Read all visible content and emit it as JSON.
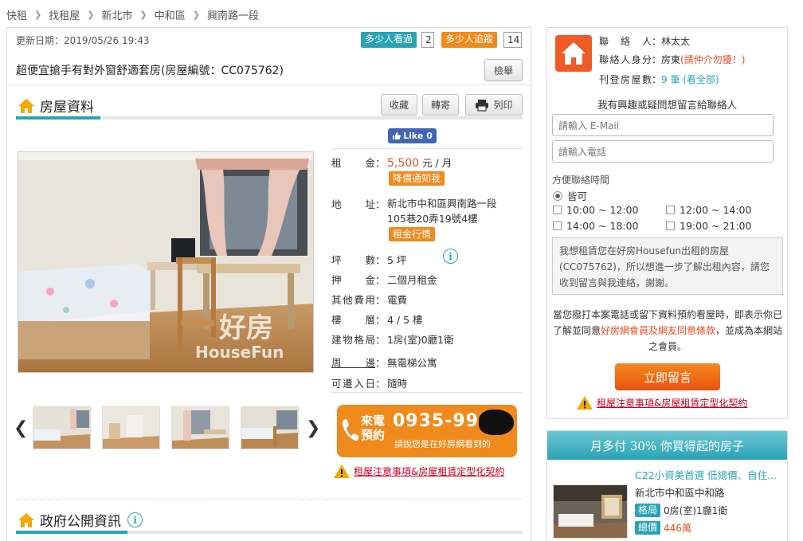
{
  "breadcrumb": [
    "快租",
    "找租屋",
    "新北市",
    "中和區",
    "興南路一段"
  ],
  "listing": {
    "update_date": "更新日期：2019/05/26 19:43",
    "watch_label": "多少人看過",
    "watch_count": "2",
    "track_label": "多少人追蹤",
    "track_count": "14",
    "title": "超便宜搶手有對外窗舒適套房(房屋編號：CC075762)",
    "report_label": "檢舉"
  },
  "section_house": {
    "title": "房屋資料",
    "fav_label": "收藏",
    "send_label": "轉寄",
    "print_label": "列印",
    "fb_like": "Like 0"
  },
  "photo": {
    "watermark_brand": "好房",
    "watermark_sub": "HouseFun"
  },
  "specs": {
    "rent_key": "租金",
    "rent_value": "5,500",
    "rent_unit": " 元 / 月",
    "rent_tag": "降價通知我",
    "addr_key": "地址",
    "addr_line1": "新北市中和區興南路一段",
    "addr_line2": "105巷20弄19號4樓",
    "addr_tag": "租金行情",
    "size_key": "坪數",
    "size_value": "5 坪",
    "deposit_key": "押金",
    "deposit_value": "二個月租金",
    "fee_key": "其他費用",
    "fee_value": "電費",
    "floor_key": "樓層",
    "floor_value": "4 / 5 樓",
    "layout_key": "建物格局",
    "layout_value": "1房(室)0廳1衛",
    "surround_key": "周邊",
    "surround_value": "無電梯公寓",
    "movein_key": "可遷入日",
    "movein_value": "隨時"
  },
  "call": {
    "label": "來電預約",
    "number": "0935-999-",
    "note": "請說您是在好房網看到的"
  },
  "warn_link": "租屋注意事項&房屋租賃定型化契約",
  "section_gov": {
    "title": "政府公開資訊"
  },
  "contact": {
    "person_key": "聯絡人",
    "person_value": "林太太",
    "identity_key": "聯絡人身分",
    "identity_value": "房東",
    "identity_note": "(請仲介勿擾！)",
    "count_key": "刊登房屋數",
    "count_value": "9 筆",
    "count_link": "(看全部)",
    "heading": "我有興趣或疑問想留言給聯絡人",
    "email_placeholder": "請輸入 E-Mail",
    "phone_placeholder": "請輸入電話",
    "time_heading": "方便聯絡時間",
    "anytime": "皆可",
    "slot1": "10:00 ~ 12:00",
    "slot2": "12:00 ~ 14:00",
    "slot3": "14:00 ~ 18:00",
    "slot4": "19:00 ~ 21:00",
    "message": "我想租賃您在好房Housefun出租的房屋(CC075762)，所以想進一步了解出租內容，請您收到留言與我連絡，謝謝。",
    "disclaimer_a": "當您撥打本案電話或留下資料預約看屋時，即表示你已了解並同意",
    "disclaimer_link": "好房網會員及網友同意條款",
    "disclaimer_b": "，並成為本網站之會員。",
    "submit": "立即留言"
  },
  "promo": {
    "header": "月多付 30% 你買得起的房子",
    "title": "C22小資美首選 低總價、自住...",
    "address": "新北市中和區中和路",
    "layout_tag": "格局",
    "layout_value": "0房(室)1廳1衛",
    "price_tag": "總價",
    "price_value": "446萬"
  },
  "colors": {
    "accent": "#29a3b6",
    "orange": "#f08a1c",
    "red": "#e44d26",
    "warn": "#c8001f"
  }
}
